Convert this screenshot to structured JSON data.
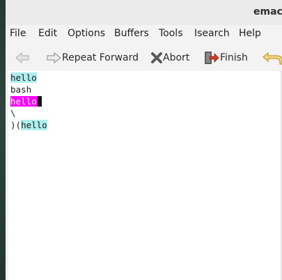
{
  "window": {
    "title": "emacs"
  },
  "menubar": {
    "items": [
      "File",
      "Edit",
      "Options",
      "Buffers",
      "Tools",
      "Isearch",
      "Help"
    ]
  },
  "toolbar": {
    "repeat_forward_label": "Repeat Forward",
    "abort_label": "Abort",
    "finish_label": "Finish"
  },
  "editor": {
    "lines": [
      {
        "match": "hello",
        "rest": ""
      },
      {
        "text": "bash"
      },
      {
        "current_match": "hello"
      },
      {
        "text": "\\"
      },
      {
        "prefix": ")(",
        "match": "hello"
      }
    ]
  },
  "colors": {
    "lazy_highlight": "#afeeee",
    "current_match": "#ff00ff"
  }
}
